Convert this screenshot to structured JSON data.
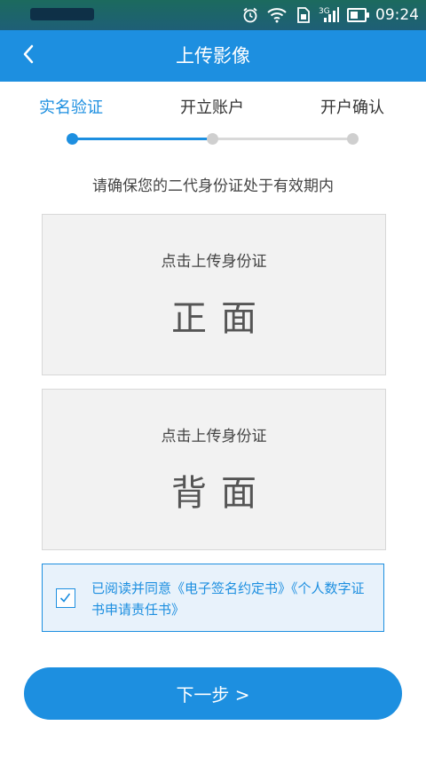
{
  "status_bar": {
    "network": "3G",
    "time": "09:24",
    "icons": [
      "alarm-icon",
      "wifi-icon",
      "sim-icon",
      "signal-icon",
      "battery-icon"
    ]
  },
  "header": {
    "back_label": "<",
    "title": "上传影像"
  },
  "steps": [
    {
      "label": "实名验证",
      "active": true
    },
    {
      "label": "开立账户",
      "active": false
    },
    {
      "label": "开户确认",
      "active": false
    }
  ],
  "notice": "请确保您的二代身份证处于有效期内",
  "id_front": {
    "tip": "点击上传身份证",
    "side": "正面"
  },
  "id_back": {
    "tip": "点击上传身份证",
    "side": "背面"
  },
  "agreement": {
    "checked": true,
    "prefix": "已阅读并同意",
    "doc1": "《电子签名约定书》",
    "doc2": "《个人数字证书申请责任书》"
  },
  "next_button": "下一步 >",
  "colors": {
    "primary": "#1d8fe0",
    "inactive": "#cfcfcf",
    "card_bg": "#f2f2f2"
  }
}
